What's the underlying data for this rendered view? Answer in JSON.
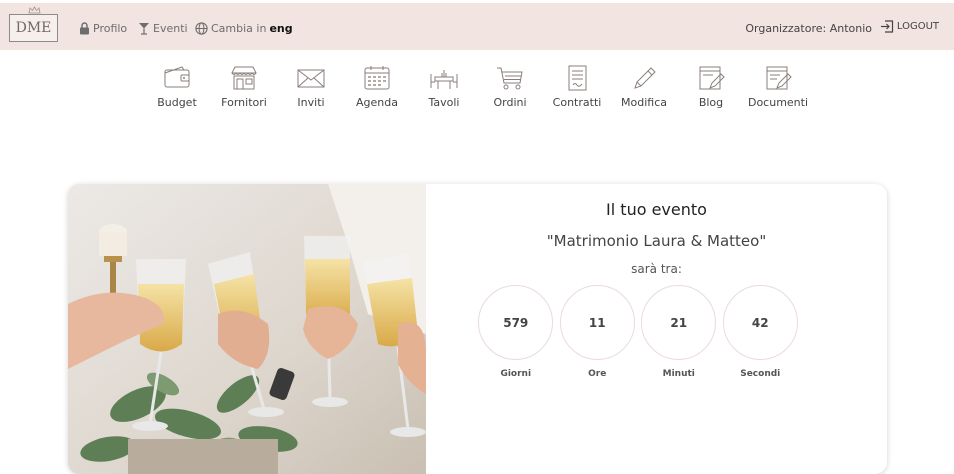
{
  "topbar": {
    "logo_text": "DME",
    "profile_label": "Profilo",
    "events_label": "Eventi",
    "language_label": "Cambia in",
    "language_value": "eng",
    "organizer_text": "Organizzatore: Antonio",
    "logout_label": "LOGOUT"
  },
  "menu": {
    "items": [
      {
        "label": "Budget",
        "icon": "wallet-icon"
      },
      {
        "label": "Fornitori",
        "icon": "shop-icon"
      },
      {
        "label": "Inviti",
        "icon": "envelope-icon"
      },
      {
        "label": "Agenda",
        "icon": "calendar-icon"
      },
      {
        "label": "Tavoli",
        "icon": "table-icon"
      },
      {
        "label": "Ordini",
        "icon": "cart-icon"
      },
      {
        "label": "Contratti",
        "icon": "contract-icon"
      },
      {
        "label": "Modifica",
        "icon": "pencil-icon"
      },
      {
        "label": "Blog",
        "icon": "blog-icon"
      },
      {
        "label": "Documenti",
        "icon": "documents-icon"
      }
    ]
  },
  "event": {
    "title": "Il tuo evento",
    "name": "\"Matrimonio Laura & Matteo\"",
    "subtitle": "sarà tra:",
    "countdown": [
      {
        "value": "579",
        "label": "Giorni"
      },
      {
        "value": "11",
        "label": "Ore"
      },
      {
        "value": "21",
        "label": "Minuti"
      },
      {
        "value": "42",
        "label": "Secondi"
      }
    ]
  },
  "colors": {
    "topbar_bg": "#f2e4e0",
    "icon_stroke": "#8a7e7a",
    "circle_border": "#eadcd8"
  }
}
